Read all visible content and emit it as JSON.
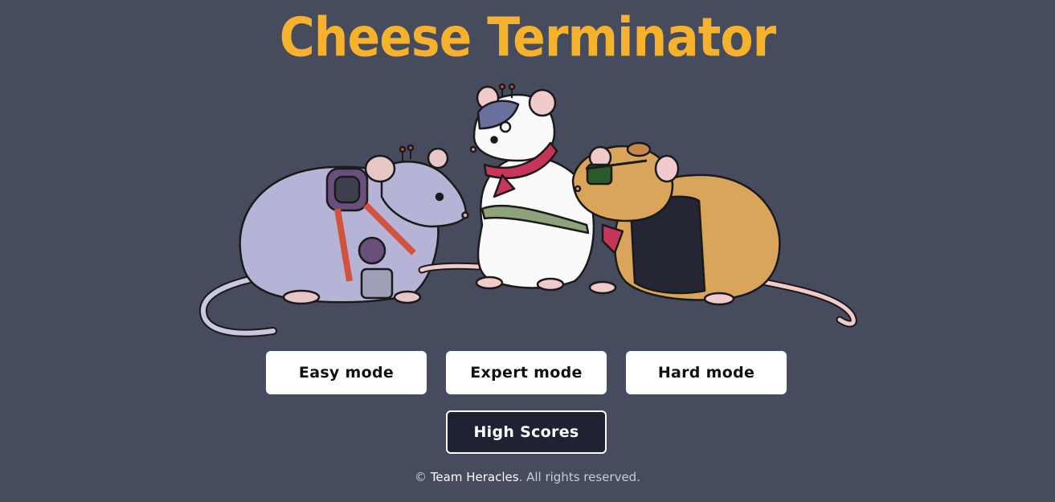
{
  "title": "Cheese Terminator",
  "colors": {
    "background": "#464b5d",
    "title": "#f6b12d",
    "button_light": "#ffffff",
    "button_dark": "#1f2331"
  },
  "hero": {
    "image": "three-cyborg-rats-illustration",
    "rats": [
      "lavender-cyborg-rat-with-eyepatch",
      "white-rat-with-scarf",
      "orange-rat-with-sunglasses-and-jacket"
    ]
  },
  "buttons": {
    "easy": "Easy mode",
    "expert": "Expert mode",
    "hard": "Hard mode",
    "high_scores": "High Scores"
  },
  "footer": {
    "copyright_symbol": "©",
    "team": "Team Heracles",
    "rights": ". All rights reserved."
  }
}
